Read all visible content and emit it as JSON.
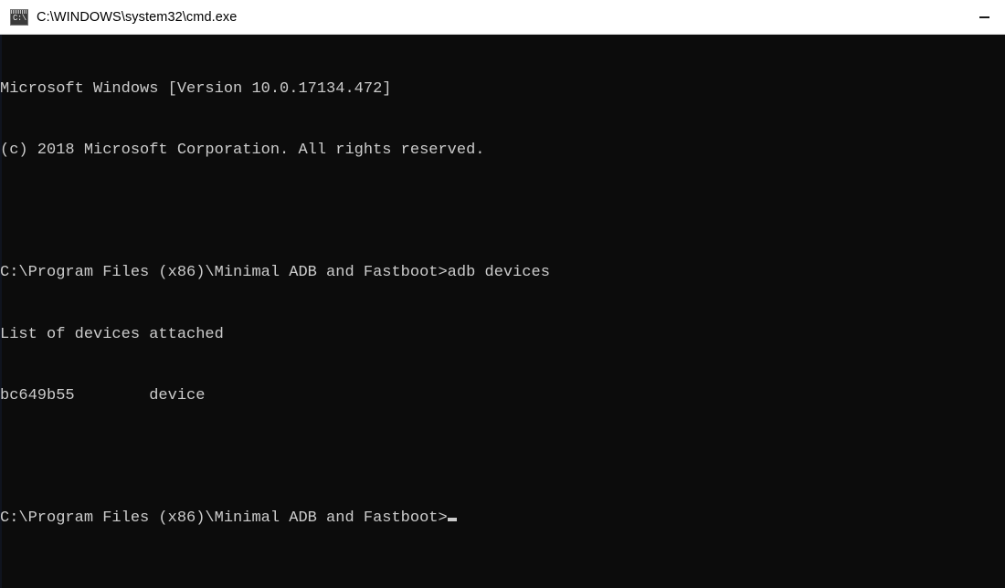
{
  "window": {
    "title": "C:\\WINDOWS\\system32\\cmd.exe",
    "icon": "cmd-console-icon",
    "icon_glyph": "C:\\",
    "background_color": "#0c0c0c",
    "titlebar_color": "#ffffff",
    "text_color": "#cccccc"
  },
  "titlebar": {
    "minimize_label": "—"
  },
  "console": {
    "lines": [
      "Microsoft Windows [Version 10.0.17134.472]",
      "(c) 2018 Microsoft Corporation. All rights reserved.",
      "",
      "C:\\Program Files (x86)\\Minimal ADB and Fastboot>adb devices",
      "List of devices attached",
      "bc649b55        device",
      "",
      ""
    ],
    "prompt_line": "C:\\Program Files (x86)\\Minimal ADB and Fastboot>",
    "banner": {
      "os_line": "Microsoft Windows [Version 10.0.17134.472]",
      "version": "10.0.17134.472",
      "copyright_line": "(c) 2018 Microsoft Corporation. All rights reserved.",
      "copyright_year": "2018"
    },
    "command": {
      "working_directory": "C:\\Program Files (x86)\\Minimal ADB and Fastboot",
      "prompt_symbol": ">",
      "entered": "adb devices"
    },
    "output": {
      "header": "List of devices attached",
      "devices": [
        {
          "serial": "bc649b55",
          "state": "device"
        }
      ]
    },
    "cursor": "_"
  }
}
